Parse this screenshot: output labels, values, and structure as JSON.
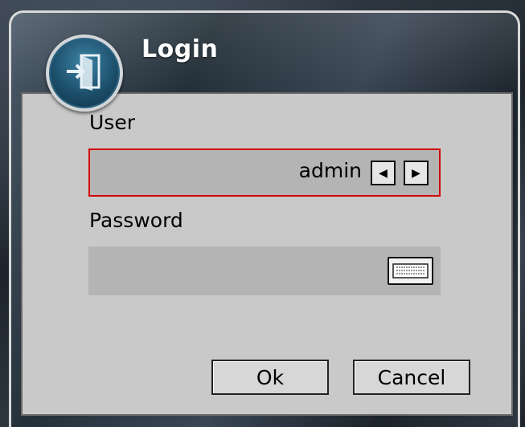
{
  "dialog": {
    "title": "Login",
    "icon": "login-door-icon"
  },
  "user": {
    "label": "User",
    "value": "admin",
    "prev_icon": "◀",
    "next_icon": "▶"
  },
  "password": {
    "label": "Password",
    "value": "",
    "keyboard_icon": "keyboard-icon"
  },
  "buttons": {
    "ok_label": "Ok",
    "cancel_label": "Cancel"
  },
  "colors": {
    "focus_border": "#d40000",
    "panel_bg": "#c9c9c9",
    "field_bg": "#b4b4b4"
  }
}
